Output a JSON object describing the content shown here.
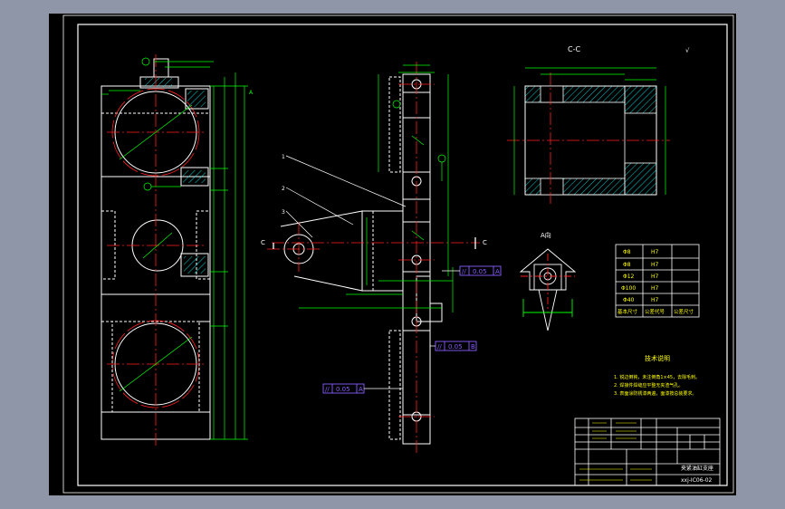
{
  "drawing": {
    "section_title": "C-C",
    "view_a_title": "A向",
    "view_a_note": "",
    "section_mark_left": "C",
    "section_mark_right": "C",
    "view_arrow_label": "A",
    "roughness_note": "√",
    "tolerances": [
      {
        "symbol": "//",
        "value": "0.05",
        "datum": "A"
      },
      {
        "symbol": "//",
        "value": "0.05",
        "datum": "B"
      },
      {
        "symbol": "//",
        "value": "0.05",
        "datum": "A"
      }
    ],
    "leaders": [
      "1",
      "2",
      "3"
    ],
    "tech_title": "技术说明",
    "tech_notes": [
      "1. 锐边倒钝，未注倒角1×45，去除毛刺。",
      "2. 焊接件焊缝应平整无夹渣气孔。",
      "3. 表面涂防锈漆两遍，面漆按总装要求。"
    ],
    "spec_table": {
      "header": [
        "基本尺寸",
        "公差代号",
        "公差尺寸"
      ],
      "rows": [
        [
          "Φ8",
          "H7",
          ""
        ],
        [
          "Φ8",
          "H7",
          ""
        ],
        [
          "Φ12",
          "H7",
          ""
        ],
        [
          "Φ100",
          "H7",
          ""
        ],
        [
          "Φ40",
          "H7",
          ""
        ]
      ]
    },
    "title_block": {
      "name": "夹紧油缸支座",
      "code": "xxj-IC06-02",
      "rows": [
        "",
        "",
        "",
        "",
        ""
      ]
    }
  },
  "colors": {
    "canvas_bg": "#000000",
    "window_bg": "#8e96a7",
    "frame": "#ffffff",
    "object_line": "#ffffff",
    "dimension": "#00ff00",
    "center_line": "#ff2020",
    "hatch": "#00ffff",
    "annotation": "#8a5cff",
    "text": "#ffffff"
  }
}
